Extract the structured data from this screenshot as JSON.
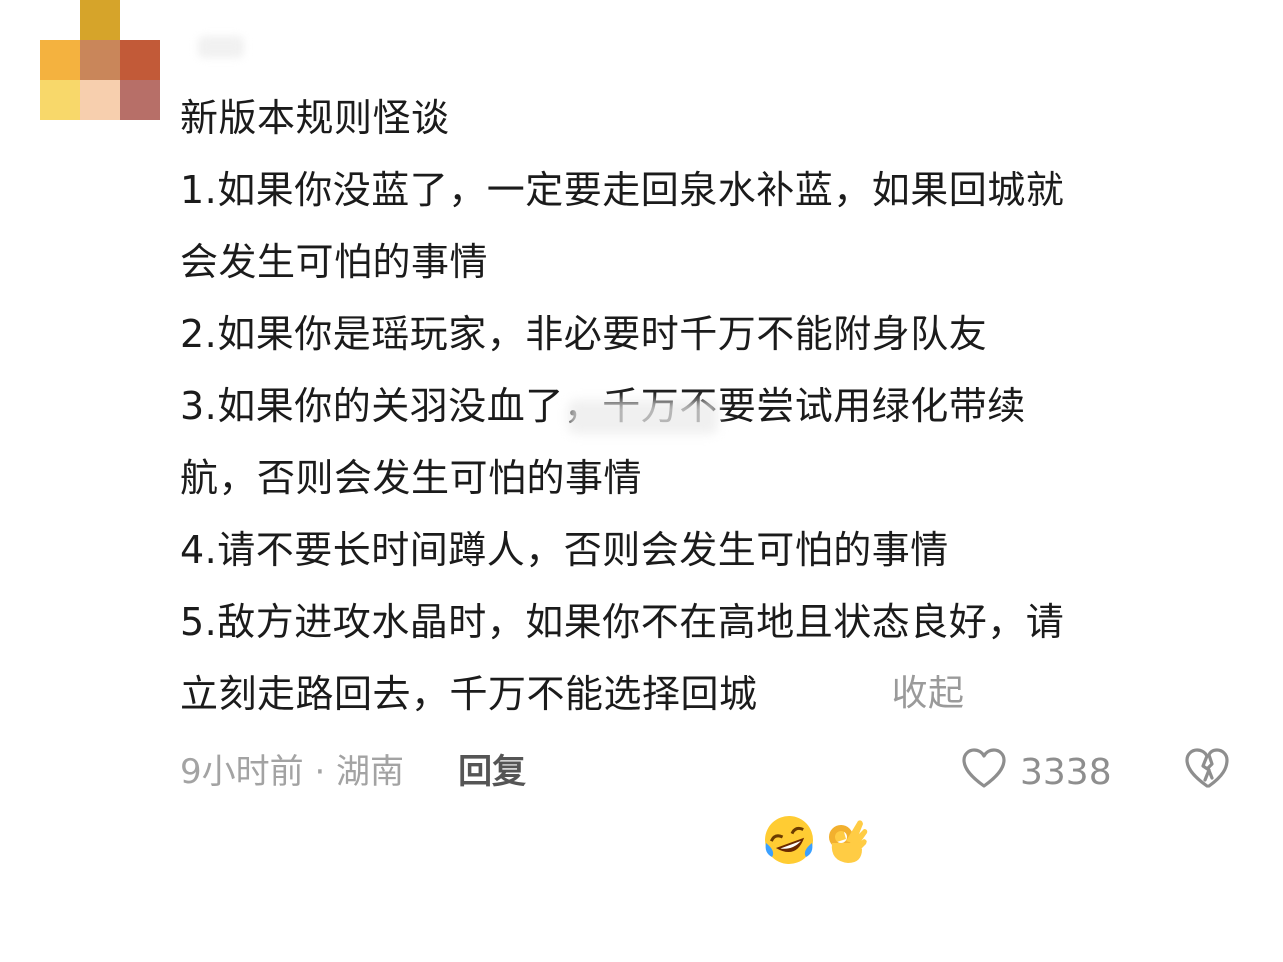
{
  "comment": {
    "title": "新版本规则怪谈",
    "lines": [
      "1.如果你没蓝了，一定要走回泉水补蓝，如果回城就",
      "会发生可怕的事情",
      "2.如果你是瑶玩家，非必要时千万不能附身队友",
      "3.如果你的关羽没血了，千万不要尝试用绿化带续",
      "航，否则会发生可怕的事情",
      "4.请不要长时间蹲人，否则会发生可怕的事情",
      "5.敌方进攻水晶时，如果你不在高地且状态良好，请"
    ],
    "last_line": "立刻走路回去，千万不能选择回城",
    "emojis": [
      "rofl-emoji",
      "ok-hand-emoji"
    ],
    "collapse_label": "收起"
  },
  "footer": {
    "time_location": "9小时前 · 湖南",
    "reply_label": "回复",
    "like_count": "3338"
  },
  "colors": {
    "text": "#1b1b1b",
    "muted": "#9a9a9a",
    "icon": "#8e8e8e"
  }
}
